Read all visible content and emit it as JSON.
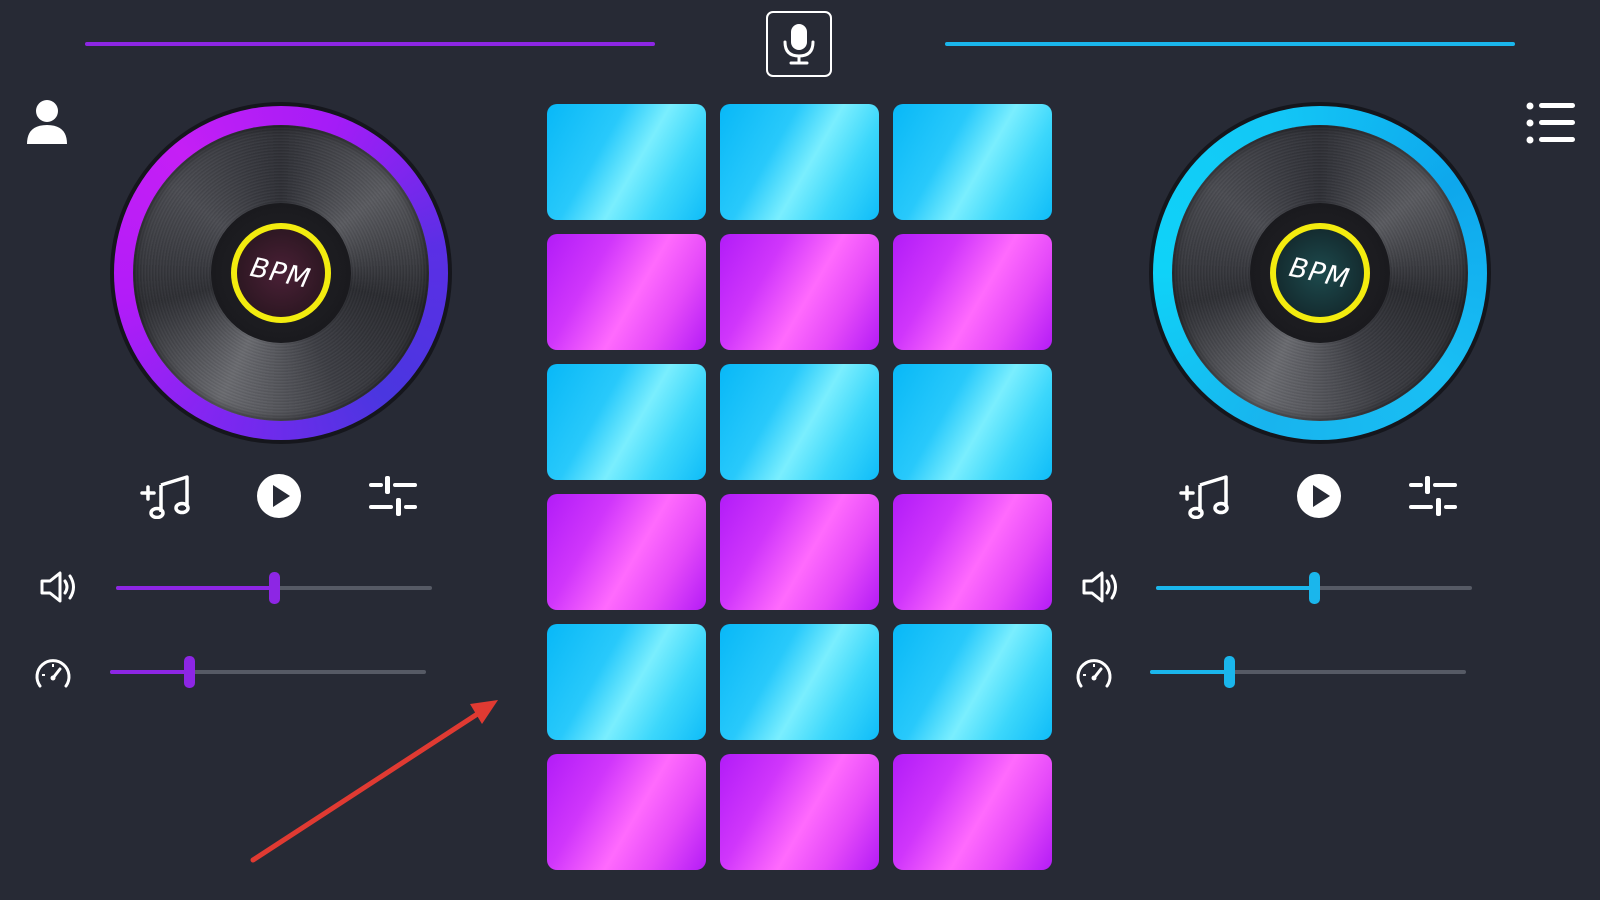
{
  "colors": {
    "background": "#272a35",
    "deck_left_accent": "#8d26e4",
    "deck_right_accent": "#1ab6ec",
    "bpm_ring": "#f3ec0f",
    "pad_cyan": "#28c9fb",
    "pad_magenta": "#ff6afd",
    "annotation_arrow": "#e03a32"
  },
  "icons": {
    "mic": "mic-icon",
    "profile": "user-icon",
    "menu": "list-menu-icon",
    "add_music": "add-music-icon",
    "play": "play-icon",
    "mixer": "equalizer-sliders-icon",
    "volume": "speaker-volume-icon",
    "speed": "speedometer-icon"
  },
  "deck_left": {
    "bpm_label": "BPM",
    "volume_level": 0.5,
    "speed_level": 0.25
  },
  "deck_right": {
    "bpm_label": "BPM",
    "volume_level": 0.5,
    "speed_level": 0.25
  },
  "pads": {
    "rows": [
      [
        "cyan",
        "cyan",
        "cyan"
      ],
      [
        "magenta",
        "magenta",
        "magenta"
      ],
      [
        "cyan",
        "cyan",
        "cyan"
      ],
      [
        "magenta",
        "magenta",
        "magenta"
      ],
      [
        "cyan",
        "cyan",
        "cyan"
      ],
      [
        "magenta",
        "magenta",
        "magenta"
      ]
    ]
  }
}
